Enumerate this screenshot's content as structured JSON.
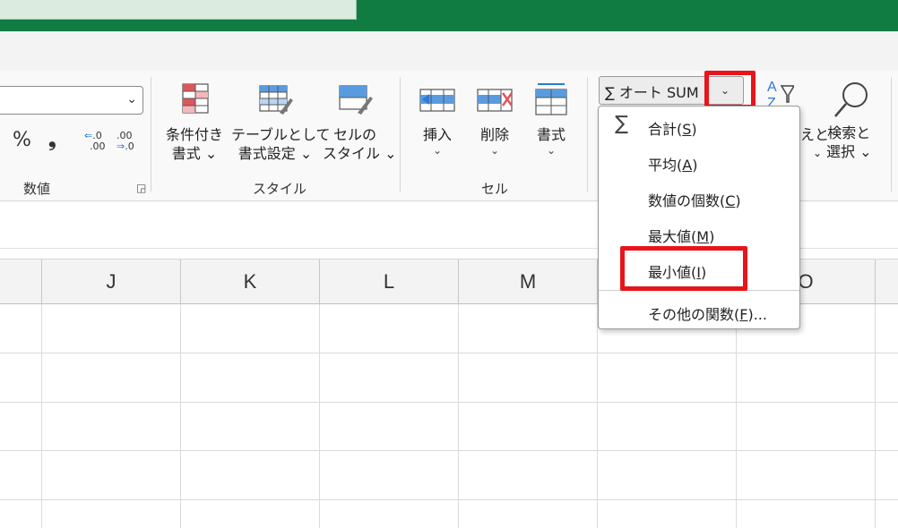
{
  "ribbon": {
    "number_group": {
      "label": "数値",
      "percent_label": "%",
      "comma_label": "❟",
      "increase_decimal": {
        "arrow": "⇐",
        "digits": ".0",
        "digits2": ".00"
      },
      "decrease_decimal": {
        "digits": ".00",
        "arrow": "⇒",
        "digits2": ".0"
      }
    },
    "style_group": {
      "label": "スタイル",
      "conditional_format": {
        "line1": "条件付き",
        "line2": "書式 ⌄"
      },
      "format_as_table": {
        "line1": "テーブルとして",
        "line2": "書式設定 ⌄"
      },
      "cell_styles": {
        "line1": "セルの",
        "line2": "スタイル ⌄"
      }
    },
    "cells_group": {
      "label": "セル",
      "insert": {
        "line1": "挿入",
        "line2": "⌄"
      },
      "delete": {
        "line1": "削除",
        "line2": "⌄"
      },
      "format": {
        "line1": "書式",
        "line2": "⌄"
      }
    },
    "editing_group": {
      "autosum_label": "∑ オート SUM",
      "autosum_dropdown": "⌄",
      "sort_filter_partial": {
        "line1": "えと",
        "line2": "⌄"
      },
      "find_select": {
        "line1": "検索と",
        "line2": "選択 ⌄"
      }
    }
  },
  "columns": [
    "J",
    "K",
    "L",
    "M",
    "",
    "O"
  ],
  "autosum_menu": {
    "sum_symbol": "∑",
    "items": [
      {
        "label": "合計(",
        "key": "S",
        "end": ")"
      },
      {
        "label": "平均(",
        "key": "A",
        "end": ")"
      },
      {
        "label": "数値の個数(",
        "key": "C",
        "end": ")"
      },
      {
        "label": "最大値(",
        "key": "M",
        "end": ")"
      },
      {
        "label": "最小値(",
        "key": "I",
        "end": ")"
      },
      {
        "label": "その他の関数(",
        "key": "F",
        "end": ")..."
      }
    ]
  },
  "colors": {
    "title_bar": "#107c41",
    "highlight": "#e8141a",
    "icon_blue": "#2b7ad6",
    "icon_red": "#e0555c"
  }
}
